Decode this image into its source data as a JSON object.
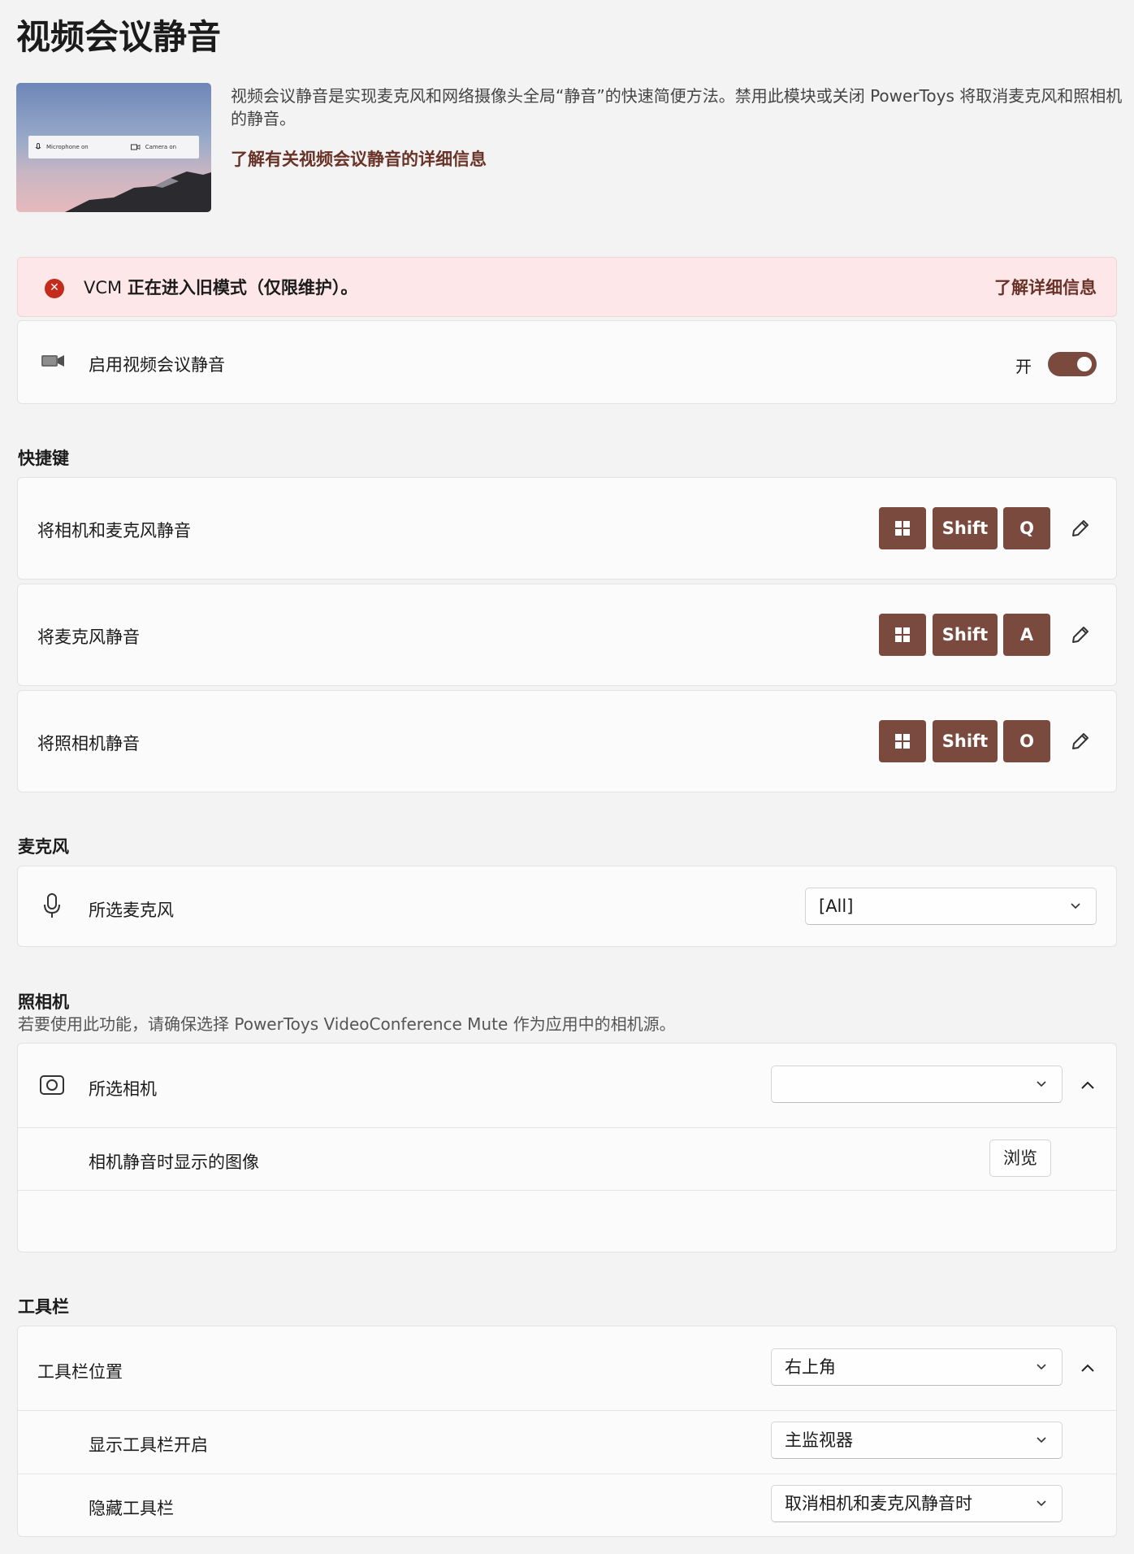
{
  "page": {
    "title": "视频会议静音",
    "description": "视频会议静音是实现麦克风和网络摄像头全局“静音”的快速简便方法。禁用此模块或关闭 PowerToys 将取消麦克风和照相机的静音。",
    "learn_more": "了解有关视频会议静音的详细信息",
    "hero": {
      "mic_label": "Microphone on",
      "camera_label": "Camera on"
    }
  },
  "warning": {
    "prefix": "VCM ",
    "text": "正在进入旧模式（仅限维护）。",
    "link": "了解详细信息",
    "icon": "error-icon"
  },
  "enable": {
    "label": "启用视频会议静音",
    "state_label": "开",
    "enabled": true,
    "accent": "#7b4a3f"
  },
  "shortcuts": {
    "title": "快捷键",
    "items": [
      {
        "label": "将相机和麦克风静音",
        "keys": [
          "Win",
          "Shift",
          "Q"
        ]
      },
      {
        "label": "将麦克风静音",
        "keys": [
          "Win",
          "Shift",
          "A"
        ]
      },
      {
        "label": "将照相机静音",
        "keys": [
          "Win",
          "Shift",
          "O"
        ]
      }
    ]
  },
  "microphone": {
    "title": "麦克风",
    "label": "所选麦克风",
    "value": "[All]"
  },
  "camera": {
    "title": "照相机",
    "subtitle": "若要使用此功能，请确保选择 PowerToys VideoConference Mute 作为应用中的相机源。",
    "label": "所选相机",
    "value": "",
    "image_label": "相机静音时显示的图像",
    "browse": "浏览"
  },
  "toolbar": {
    "title": "工具栏",
    "position_label": "工具栏位置",
    "position_value": "右上角",
    "show_on_label": "显示工具栏开启",
    "show_on_value": "主监视器",
    "hide_label": "隐藏工具栏",
    "hide_value": "取消相机和麦克风静音时"
  }
}
